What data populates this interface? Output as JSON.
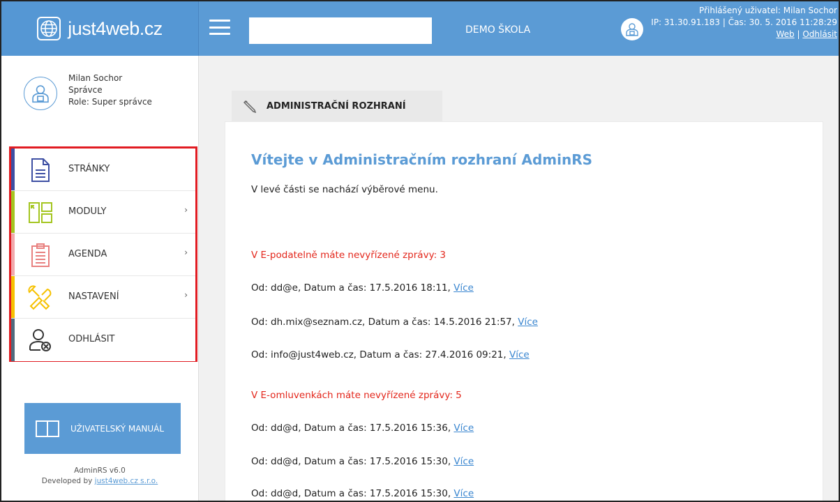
{
  "header": {
    "logo_text": "just4web.cz",
    "search_value": "",
    "school_name": "DEMO ŠKOLA",
    "user_line": "Přihlášený uživatel: Milan Sochor",
    "ip_line": "IP: 31.30.91.183 | Čas: 30. 5. 2016 11:28:29",
    "link_web": "Web",
    "link_separator": " | ",
    "link_logout": "Odhlásit"
  },
  "profile": {
    "name": "Milan Sochor",
    "position": "Správce",
    "role": "Role: Super správce"
  },
  "menu": {
    "items": [
      {
        "label": "STRÁNKY",
        "icon": "document-icon",
        "color": "#3d4fa3",
        "has_submenu": false
      },
      {
        "label": "MODULY",
        "icon": "modules-icon",
        "color": "#a4c520",
        "has_submenu": true
      },
      {
        "label": "AGENDA",
        "icon": "clipboard-icon",
        "color": "#f2a8ab",
        "has_submenu": true
      },
      {
        "label": "NASTAVENÍ",
        "icon": "tools-icon",
        "color": "#f6c100",
        "has_submenu": true
      },
      {
        "label": "ODHLÁSIT",
        "icon": "user-logout-icon",
        "color": "#4f6b7e",
        "has_submenu": false
      }
    ],
    "chevron": "›"
  },
  "manual": {
    "label": "UŽIVATELSKÝ MANUÁL"
  },
  "footer": {
    "version": "AdminRS v6.0",
    "developed_by": "Developed by ",
    "developer_link": "just4web.cz s.r.o."
  },
  "content": {
    "tab_label": "ADMINISTRAČNÍ ROZHRANÍ",
    "welcome_title": "Vítejte v Administračním rozhraní AdminRS",
    "intro": "V levé části se nachází výběrové menu.",
    "section1_title": "V E-podatelně máte nevyřízené zprávy: 3",
    "section1_messages": [
      {
        "text": "Od: dd@e, Datum a čas: 17.5.2016 18:11, ",
        "link": "Více"
      },
      {
        "text": "Od: dh.mix@seznam.cz, Datum a čas: 14.5.2016 21:57, ",
        "link": "Více"
      },
      {
        "text": "Od: info@just4web.cz, Datum a čas: 27.4.2016 09:21, ",
        "link": "Více"
      }
    ],
    "section2_title": "V E-omluvenkách máte nevyřízené zprávy: 5",
    "section2_messages": [
      {
        "text": "Od: dd@d, Datum a čas: 17.5.2016 15:36, ",
        "link": "Více"
      },
      {
        "text": "Od: dd@d, Datum a čas: 17.5.2016 15:30, ",
        "link": "Více"
      },
      {
        "text": "Od: dd@d, Datum a čas: 17.5.2016 15:30, ",
        "link": "Více"
      }
    ]
  },
  "colors": {
    "accent": "#5b9bd5",
    "alert": "#e3261b",
    "highlight_border": "#e11c22"
  }
}
